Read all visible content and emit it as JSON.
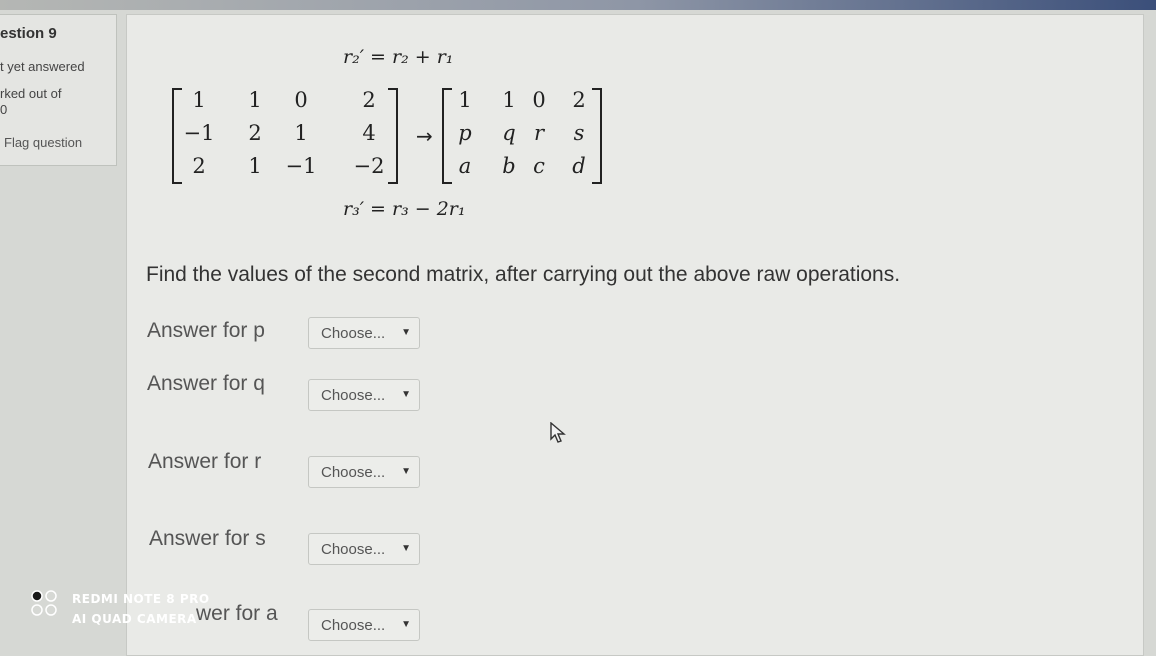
{
  "info": {
    "question_label": "estion",
    "question_number": "9",
    "status": "t yet answered",
    "marked": "rked out of",
    "marked_value": "0",
    "flag": "Flag question"
  },
  "equations": {
    "top": "r₂′ = r₂ + r₁",
    "bottom": "r₃′ = r₃ − 2r₁",
    "arrow": "→"
  },
  "matrix_left": [
    [
      "1",
      "1",
      "0",
      "2"
    ],
    [
      "−1",
      "2",
      "1",
      "4"
    ],
    [
      "2",
      "1",
      "−1",
      "−2"
    ]
  ],
  "matrix_right": [
    [
      "1",
      "1",
      "0",
      "2"
    ],
    [
      "p",
      "q",
      "r",
      "s"
    ],
    [
      "a",
      "b",
      "c",
      "d"
    ]
  ],
  "instruction": "Find the values of the second matrix, after carrying out the above raw operations.",
  "answers": [
    {
      "label": "Answer for p",
      "select": "Choose..."
    },
    {
      "label": "Answer for q",
      "select": "Choose..."
    },
    {
      "label": "Answer for r",
      "select": "Choose..."
    },
    {
      "label": "Answer for s",
      "select": "Choose..."
    },
    {
      "label": "wer for a",
      "select": "Choose..."
    }
  ],
  "watermark": {
    "line1": "REDMI NOTE 8 PRO",
    "line2": "AI QUAD CAMERA"
  }
}
